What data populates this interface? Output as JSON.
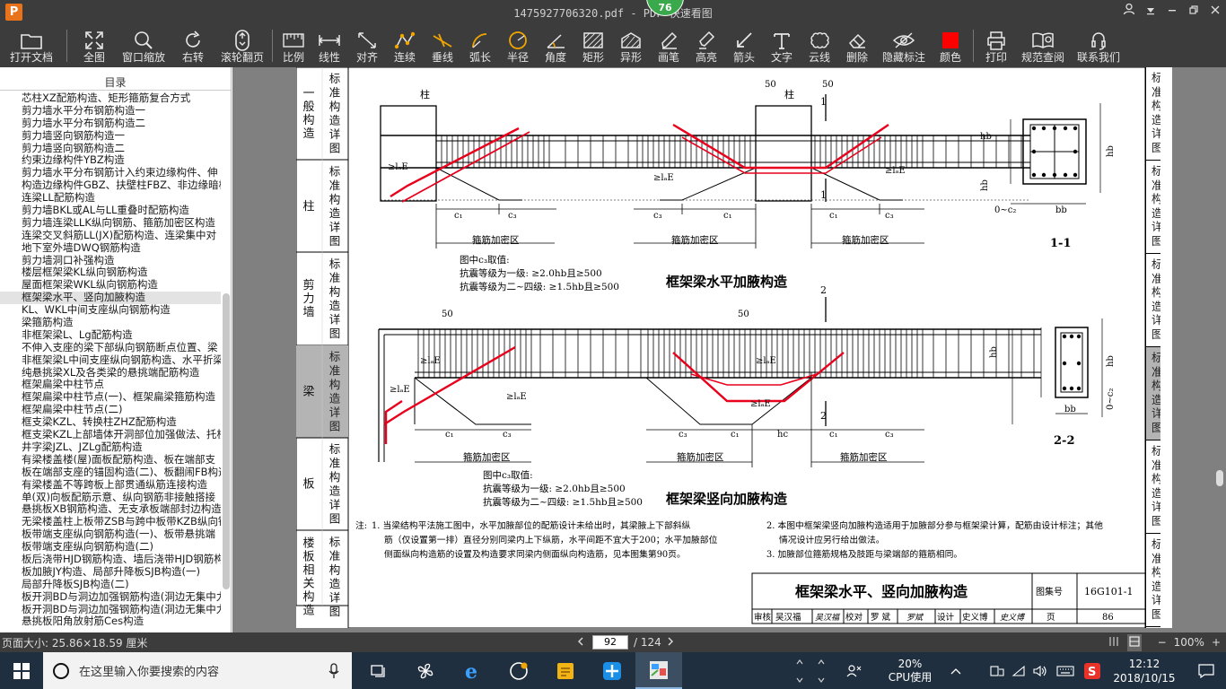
{
  "window": {
    "title": "1475927706320.pdf - PDF 快速看图",
    "badge": "76",
    "buttons": [
      "user-icon",
      "dropdown-icon",
      "minimize-icon",
      "restore-icon",
      "close-icon"
    ]
  },
  "toolbar": {
    "items": [
      {
        "label": "打开文档",
        "icon": "folder-icon"
      },
      {
        "label": "全图",
        "icon": "fit-all-icon"
      },
      {
        "label": "窗口缩放",
        "icon": "zoom-icon"
      },
      {
        "label": "右转",
        "icon": "rotate-right-icon"
      },
      {
        "label": "滚轮翻页",
        "icon": "mouse-icon"
      },
      {
        "label": "比例",
        "icon": "scale-icon"
      },
      {
        "label": "线性",
        "icon": "linear-icon"
      },
      {
        "label": "对齐",
        "icon": "align-icon"
      },
      {
        "label": "连续",
        "icon": "continuous-icon"
      },
      {
        "label": "垂线",
        "icon": "perpendicular-icon"
      },
      {
        "label": "弧长",
        "icon": "arc-length-icon"
      },
      {
        "label": "半径",
        "icon": "radius-icon"
      },
      {
        "label": "角度",
        "icon": "angle-icon"
      },
      {
        "label": "矩形",
        "icon": "rectangle-icon"
      },
      {
        "label": "异形",
        "icon": "irregular-icon"
      },
      {
        "label": "画笔",
        "icon": "pen-icon"
      },
      {
        "label": "高亮",
        "icon": "highlight-icon"
      },
      {
        "label": "箭头",
        "icon": "arrow-icon"
      },
      {
        "label": "文字",
        "icon": "text-icon"
      },
      {
        "label": "云线",
        "icon": "cloud-icon"
      },
      {
        "label": "删除",
        "icon": "eraser-icon"
      },
      {
        "label": "隐藏标注",
        "icon": "hide-icon"
      },
      {
        "label": "颜色",
        "icon": "color-icon",
        "color": "#ff0000"
      },
      {
        "label": "打印",
        "icon": "print-icon"
      },
      {
        "label": "规范查阅",
        "icon": "book-icon"
      },
      {
        "label": "联系我们",
        "icon": "contact-icon"
      }
    ]
  },
  "toc": {
    "title": "目录",
    "items": [
      "芯柱XZ配筋构造、矩形箍筋复合方式",
      "剪力墙水平分布钢筋构造一",
      "剪力墙水平分布钢筋构造二",
      "剪力墙竖向钢筋构造一",
      "剪力墙竖向钢筋构造二",
      "约束边缘构件YBZ构造",
      "剪力墙水平分布钢筋计入约束边缘构件、伸",
      "构造边缘构件GBZ、扶壁柱FBZ、非边缘暗柱",
      "连梁LL配筋构造",
      "剪力墙BKL或AL与LL重叠时配筋构造",
      "剪力墙连梁LLK纵向钢筋、箍筋加密区构造",
      "连梁交叉斜筋LL(JX)配筋构造、连梁集中对",
      "地下室外墙DWQ钢筋构造",
      "剪力墙洞口补强构造",
      "楼层框架梁KL纵向钢筋构造",
      "屋面框架梁WKL纵向钢筋构造",
      "框架梁水平、竖向加腋构造",
      "KL、WKL中间支座纵向钢筋构造",
      "梁箍筋构造",
      "非框架梁L、Lg配筋构造",
      "不伸入支座的梁下部纵向钢筋断点位置、梁",
      "非框架梁L中间支座纵向钢筋构造、水平折梁",
      "纯悬挑梁XL及各类梁的悬挑端配筋构造",
      "框架扁梁中柱节点",
      "框架扁梁中柱节点(一)、框架扁梁箍筋构造",
      "框架扁梁中柱节点(二)",
      "框支梁KZL、转换柱ZHZ配筋构造",
      "框支梁KZL上部墙体开洞部位加强做法、托柱",
      "井字梁JZL、JZLg配筋构造",
      "有梁楼盖楼(屋)面板配筋构造、板在端部支",
      "板在端部支座的锚固构造(二)、板翻闹FB构造",
      "有梁楼盖不等跨板上部贯通纵筋连接构造",
      "单(双)向板配筋示意、纵向钢筋非接触搭接",
      "悬挑板XB钢筋构造、无支承板端部封边构造",
      "无梁楼盖柱上板带ZSB与跨中板带KZB纵向钢",
      "板带端支座纵向钢筋构造(一)、板带悬挑端",
      "板带端支座纵向钢筋构造(二)",
      "板后浇带HJD钢筋构造、墙后浇带HJD钢筋构",
      "板加腋JY构造、局部升降板SJB构造(一)",
      "局部升降板SJB构造(二)",
      "板开洞BD与洞边加强钢筋构造(洞边无集中力",
      "板开洞BD与洞边加强钢筋构造(洞边无集中力",
      "悬挑板阳角放射筋Ces构造"
    ],
    "selected_index": 16
  },
  "page": {
    "left_tabs": [
      {
        "label": "一般构造",
        "sub": "标准构造详图"
      },
      {
        "label": "柱",
        "sub": "标准构造详图"
      },
      {
        "label": "剪力墙",
        "sub": "标准构造详图"
      },
      {
        "label": "梁",
        "sub": "标准构造详图"
      },
      {
        "label": "板",
        "sub": "标准构造详图"
      },
      {
        "label": "楼板相关构造",
        "sub": "标准构造详图"
      }
    ],
    "right_tab_label": "标准构造详图",
    "fig1": {
      "title": "框架梁水平加腋构造",
      "column_label": "柱",
      "dim50": "50",
      "lae": "≥lₐE",
      "c1": "c₁",
      "c2": "c₂",
      "c3": "c₃",
      "zone": "箍筋加密区",
      "note_title": "图中c₃取值:",
      "note_1": "抗震等级为一级: ≥2.0hb且≥500",
      "note_2": "抗震等级为二~四级: ≥1.5hb且≥500",
      "hb": "hb",
      "bb": "bb"
    },
    "fig2": {
      "title": "框架梁竖向加腋构造",
      "dim50": "50",
      "hc": "hc",
      "note_title": "图中c₃取值:",
      "note_1": "抗震等级为一级: ≥2.0hb且≥500",
      "note_2": "抗震等级为二~四级: ≥1.5hb且≥500"
    },
    "section1": {
      "label": "1-1",
      "mark": "1",
      "c2": "0~c₂",
      "bb": "bb",
      "hb": "hb"
    },
    "section2": {
      "label": "2-2",
      "mark": "2",
      "c2": "0~c₂",
      "bb": "bb",
      "hb": "hb"
    },
    "notes_prefix": "注:",
    "notes": [
      "1. 当梁结构平法施工图中，水平加腋部位的配筋设计未给出时，其梁腋上下部斜纵筋（仅设置第一排）直径分别同梁内上下纵筋，水平间距不宜大于200；水平加腋部位侧面纵向构造筋的设置及构造要求同梁内侧面纵向构造筋，见本图集第90页。",
      "2. 本图中框架梁竖向加腋构造适用于加腋部分参与框架梁计算，配筋由设计标注；其他情况设计应另行给出做法。",
      "3. 加腋部位箍筋规格及肢距与梁端部的箍筋相同。"
    ],
    "titleblock": {
      "title": "框架梁水平、竖向加腋构造",
      "atlas_label": "图集号",
      "atlas_no": "16G101-1",
      "row": [
        "审核",
        "吴汉福",
        "吴汉福",
        "校对",
        "罗 斌",
        "罗斌",
        "设计",
        "史义博",
        "史义博",
        "页",
        "86"
      ]
    }
  },
  "status": {
    "page_size": "页面大小: 25.86×18.59 厘米",
    "current_page": "92",
    "total_pages": "/ 124",
    "zoom": "100%"
  },
  "taskbar": {
    "search_placeholder": "在这里输入你要搜索的内容",
    "cpu_percent": "20%",
    "cpu_label": "CPU使用",
    "time": "12:12",
    "date": "2018/10/15"
  }
}
